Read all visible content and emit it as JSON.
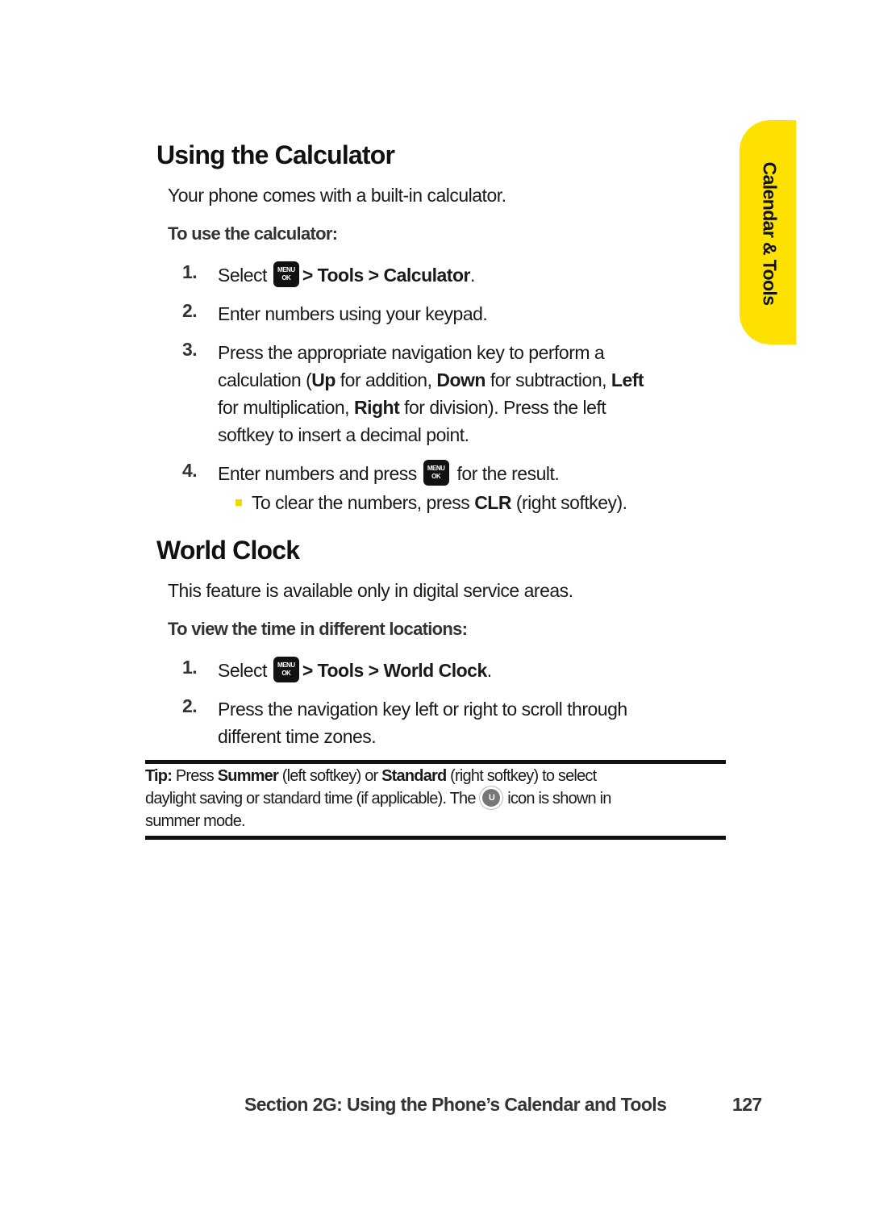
{
  "side_tab": {
    "label": "Calendar & Tools",
    "color": "#ffe100"
  },
  "calculator": {
    "title": "Using the Calculator",
    "intro": "Your phone comes with a built-in calculator.",
    "subheading": "To use the calculator:",
    "steps": [
      {
        "num": "1.",
        "pre": "Select",
        "icon": "menu-ok-key",
        "path": "> Tools > Calculator",
        "post": "."
      },
      {
        "num": "2.",
        "text": "Enter numbers using your keypad."
      },
      {
        "num": "3.",
        "line1": "Press the appropriate navigation key to perform a",
        "line2_a": "calculation (",
        "up": "Up",
        "line2_b": " for addition, ",
        "down": "Down",
        "line2_c": " for subtraction, ",
        "left": "Left",
        "line3_a": "for multiplication, ",
        "right": "Right",
        "line3_b": " for division). Press the left",
        "line4": "softkey to insert a decimal point."
      },
      {
        "num": "4.",
        "pre": "Enter numbers and press",
        "icon": "menu-ok-key",
        "post": "for the result."
      }
    ],
    "bullet": {
      "pre": "To clear the numbers, press ",
      "key": "CLR",
      "post": " (right softkey)."
    }
  },
  "world_clock": {
    "title": "World Clock",
    "intro": "This feature is available only in digital service areas.",
    "subheading": "To view the time in different locations:",
    "steps": [
      {
        "num": "1.",
        "pre": "Select",
        "icon": "menu-ok-key",
        "path": "> Tools > World Clock",
        "post": "."
      },
      {
        "num": "2.",
        "line1": "Press the navigation key left or right to scroll through",
        "line2": "different time zones."
      }
    ]
  },
  "tip": {
    "label": "Tip:",
    "a": " Press ",
    "summer": "Summer",
    "b": " (left softkey) or ",
    "standard": "Standard",
    "c": " (right softkey) to select",
    "d": "daylight saving or standard time (if applicable). The ",
    "icon": "summer-sun-icon",
    "e": " icon is shown in",
    "f": "summer mode."
  },
  "menu_key": {
    "line1": "MENU",
    "line2": "OK"
  },
  "footer": {
    "section": "Section 2G: Using the Phone’s Calendar and Tools",
    "page": "127"
  }
}
